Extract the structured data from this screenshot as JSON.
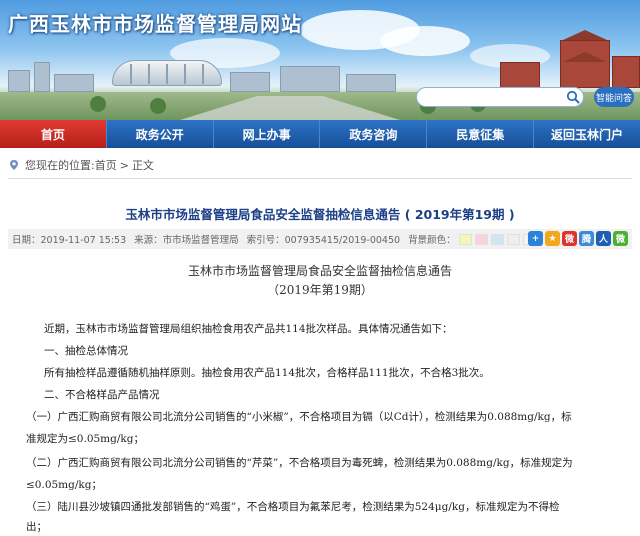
{
  "site": {
    "title": "广西玉林市市场监督管理局网站"
  },
  "search": {
    "placeholder": "",
    "button_icon": "search-icon",
    "old_version_label": "智能问答"
  },
  "nav": {
    "items": [
      {
        "label": "首页",
        "active": true
      },
      {
        "label": "政务公开",
        "active": false
      },
      {
        "label": "网上办事",
        "active": false
      },
      {
        "label": "政务咨询",
        "active": false
      },
      {
        "label": "民意征集",
        "active": false
      },
      {
        "label": "返回玉林门户",
        "active": false
      }
    ]
  },
  "breadcrumb": {
    "prefix": "您现在的位置:",
    "home": "首页",
    "separator": ">",
    "current": "正文"
  },
  "article": {
    "title": "玉林市市场监督管理局食品安全监督抽检信息通告 ( 2019年第19期 )",
    "date": "日期：2019-11-07 15:53",
    "source": "来源：市市场监督管理局",
    "index": "索引号：007935415/2019-00450",
    "bg_color_label": "背景颜色：",
    "bg_colors": [
      "#f5f5b8",
      "#f7d2de",
      "#cfe6f3",
      "#eeeeee",
      "#f4f4f4"
    ],
    "share_icons": [
      {
        "name": "plus-share-icon",
        "glyph": "+",
        "color": "#2b82d9"
      },
      {
        "name": "qzone-share-icon",
        "glyph": "★",
        "color": "#f2a81c"
      },
      {
        "name": "weibo-share-icon",
        "glyph": "微",
        "color": "#e0322d"
      },
      {
        "name": "tencent-weibo-share-icon",
        "glyph": "腾",
        "color": "#3f8ad8"
      },
      {
        "name": "renren-share-icon",
        "glyph": "人",
        "color": "#1c5fb5"
      },
      {
        "name": "wechat-share-icon",
        "glyph": "微",
        "color": "#4cb035"
      }
    ]
  },
  "doc": {
    "heading1": "玉林市市场监督管理局食品安全监督抽检信息通告",
    "heading2": "（2019年第19期）",
    "p1": "近期，玉林市市场监督管理局组织抽检食用农产品共114批次样品。具体情况通告如下：",
    "p2": "一、抽检总体情况",
    "p3": "所有抽检样品遵循随机抽样原则。抽检食用农产品114批次，合格样品111批次，不合格3批次。",
    "p4": "二、不合格样品产品情况",
    "p5a": "（一）广西汇购商贸有限公司北流分公司销售的“小米椒”，不合格项目为镉（以Cd计），检测结果为0.088mg/kg，标",
    "p5b": "准规定为≤0.05mg/kg；",
    "p6a": "（二）广西汇购商贸有限公司北流分公司销售的“芹菜”，不合格项目为毒死蜱，检测结果为0.088mg/kg，标准规定为",
    "p6b": "≤0.05mg/kg；",
    "p7a": "（三）陆川县沙坡镇四通批发部销售的“鸡蛋”，不合格项目为氟苯尼考，检测结果为524μg/kg，标准规定为不得检",
    "p7b": "出；"
  }
}
